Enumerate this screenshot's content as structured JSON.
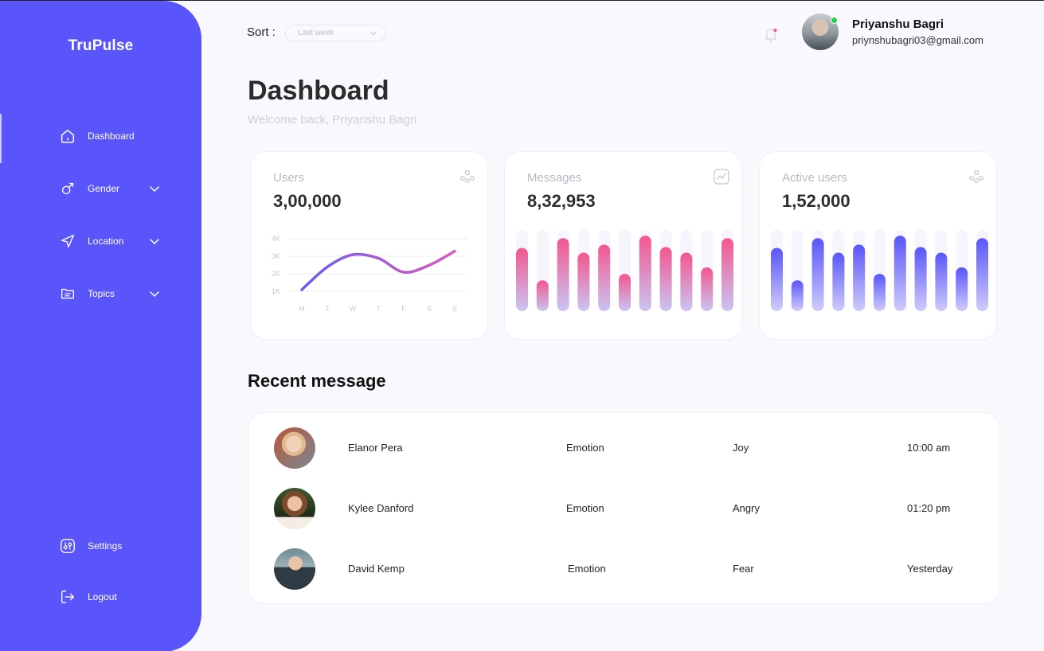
{
  "app": {
    "brand": "TruPulse"
  },
  "sidebar": {
    "items": [
      {
        "label": "Dashboard",
        "icon": "home-icon",
        "expandable": false
      },
      {
        "label": "Gender",
        "icon": "gender-icon",
        "expandable": true
      },
      {
        "label": "Location",
        "icon": "location-arrow-icon",
        "expandable": true
      },
      {
        "label": "Topics",
        "icon": "topics-icon",
        "expandable": true
      }
    ],
    "bottom": [
      {
        "label": "Settings",
        "icon": "settings-icon"
      },
      {
        "label": "Logout",
        "icon": "logout-icon"
      }
    ]
  },
  "topbar": {
    "sort_label": "Sort :",
    "sort_value": "Last week",
    "user": {
      "name": "Priyanshu Bagri",
      "email": "priynshubagri03@gmail.com",
      "status": "online"
    }
  },
  "header": {
    "title": "Dashboard",
    "subtitle": "Welcome back, Priyanshu Bagri"
  },
  "stats": [
    {
      "label": "Users",
      "value": "3,00,000",
      "icon": "users-group-icon"
    },
    {
      "label": "Messages",
      "value": "8,32,953",
      "icon": "trend-chart-icon"
    },
    {
      "label": "Active users",
      "value": "1,52,000",
      "icon": "users-group-icon"
    }
  ],
  "chart_data": [
    {
      "type": "line",
      "categories": [
        "M",
        "T",
        "W",
        "T",
        "F",
        "S",
        "S"
      ],
      "values": [
        1000,
        2300,
        3000,
        2800,
        2000,
        2400,
        3200
      ],
      "yticks": [
        "1K",
        "2K",
        "3K",
        "4K"
      ],
      "ylim": [
        0,
        4000
      ],
      "grid": true
    },
    {
      "type": "bar",
      "values": [
        78,
        38,
        90,
        72,
        82,
        46,
        93,
        79,
        72,
        54,
        90
      ],
      "ylim": [
        0,
        100
      ],
      "colors": {
        "top": "#f2578f",
        "bottom": "#c9c5f3",
        "track": "#f5f5fb"
      }
    },
    {
      "type": "bar",
      "values": [
        78,
        38,
        90,
        72,
        82,
        46,
        93,
        79,
        72,
        54,
        90
      ],
      "ylim": [
        0,
        100
      ],
      "colors": {
        "top": "#5a55fa",
        "bottom": "#cfccfb",
        "track": "#f5f5fb"
      }
    }
  ],
  "recent": {
    "title": "Recent message",
    "rows": [
      {
        "name": "Elanor Pera",
        "type": "Emotion",
        "emotion": "Joy",
        "time": "10:00 am"
      },
      {
        "name": "Kylee Danford",
        "type": "Emotion",
        "emotion": "Angry",
        "time": "01:20 pm"
      },
      {
        "name": "David Kemp",
        "type": "Emotion",
        "emotion": "Fear",
        "time": "Yesterday"
      }
    ]
  },
  "colors": {
    "accent": "#5a55fa",
    "pink": "#f2578f",
    "line_start": "#6e5cf4",
    "line_end": "#d85ab8"
  }
}
